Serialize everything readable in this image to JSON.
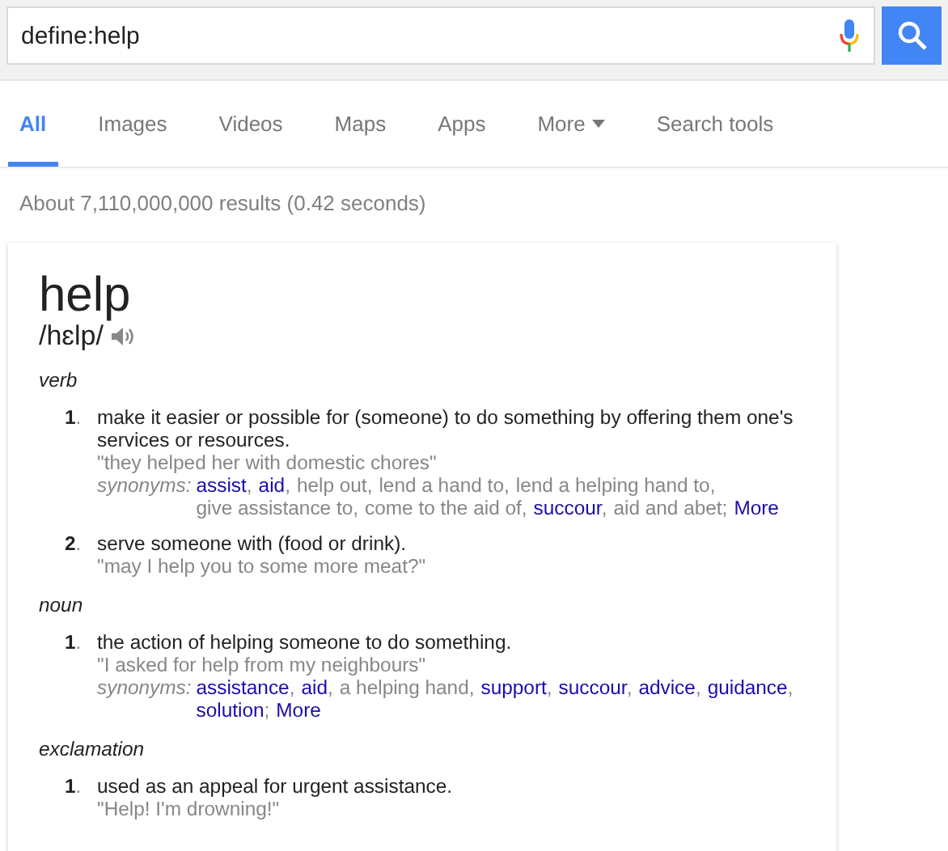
{
  "search": {
    "value": "define:help"
  },
  "tabs": [
    {
      "label": "All",
      "selected": true,
      "dropdown": false
    },
    {
      "label": "Images",
      "selected": false,
      "dropdown": false
    },
    {
      "label": "Videos",
      "selected": false,
      "dropdown": false
    },
    {
      "label": "Maps",
      "selected": false,
      "dropdown": false
    },
    {
      "label": "Apps",
      "selected": false,
      "dropdown": false
    },
    {
      "label": "More",
      "selected": false,
      "dropdown": true
    },
    {
      "label": "Search tools",
      "selected": false,
      "dropdown": false
    }
  ],
  "result_stats": "About 7,110,000,000 results (0.42 seconds)",
  "definition": {
    "word": "help",
    "phonetic": "/hɛlp/",
    "groups": [
      {
        "part_of_speech": "verb",
        "senses": [
          {
            "number": "**1**.",
            "definition": "make it easier or possible for (someone) to do something by offering them one's services or resources.",
            "example": "\"they helped her with domestic chores\"",
            "synonyms_label": "synonyms:",
            "synonyms": [
              {
                "text": "assist",
                "link": true,
                "after": ","
              },
              {
                "text": "aid",
                "link": true,
                "after": ","
              },
              {
                "text": "help out",
                "link": false,
                "after": ","
              },
              {
                "text": "lend a hand to",
                "link": false,
                "after": ","
              },
              {
                "text": "lend a helping hand to",
                "link": false,
                "after": ","
              },
              {
                "text": "give assistance to",
                "link": false,
                "after": ","
              },
              {
                "text": "come to the aid of",
                "link": false,
                "after": ","
              },
              {
                "text": "succour",
                "link": true,
                "after": ","
              },
              {
                "text": "aid and abet",
                "link": false,
                "after": ";"
              },
              {
                "text": "More",
                "link": true
              }
            ]
          },
          {
            "number": "**2**.",
            "definition": "serve someone with (food or drink).",
            "example": "\"may I help you to some more meat?\""
          }
        ]
      },
      {
        "part_of_speech": "noun",
        "senses": [
          {
            "number": "**1**.",
            "definition": "the action of helping someone to do something.",
            "example": "\"I asked for help from my neighbours\"",
            "synonyms_label": "synonyms:",
            "synonyms": [
              {
                "text": "assistance",
                "link": true,
                "after": ","
              },
              {
                "text": "aid",
                "link": true,
                "after": ","
              },
              {
                "text": "a helping hand",
                "link": false,
                "after": ","
              },
              {
                "text": "support",
                "link": true,
                "after": ","
              },
              {
                "text": "succour",
                "link": true,
                "after": ","
              },
              {
                "text": "advice",
                "link": true,
                "after": ","
              },
              {
                "text": "guidance",
                "link": true,
                "after": ","
              },
              {
                "text": "solution",
                "link": true,
                "after": ";"
              },
              {
                "text": "More",
                "link": true
              }
            ]
          }
        ]
      },
      {
        "part_of_speech": "exclamation",
        "senses": [
          {
            "number": "**1**.",
            "definition": "used as an appeal for urgent assistance.",
            "example": "\"Help! I'm drowning!\""
          }
        ]
      }
    ]
  }
}
